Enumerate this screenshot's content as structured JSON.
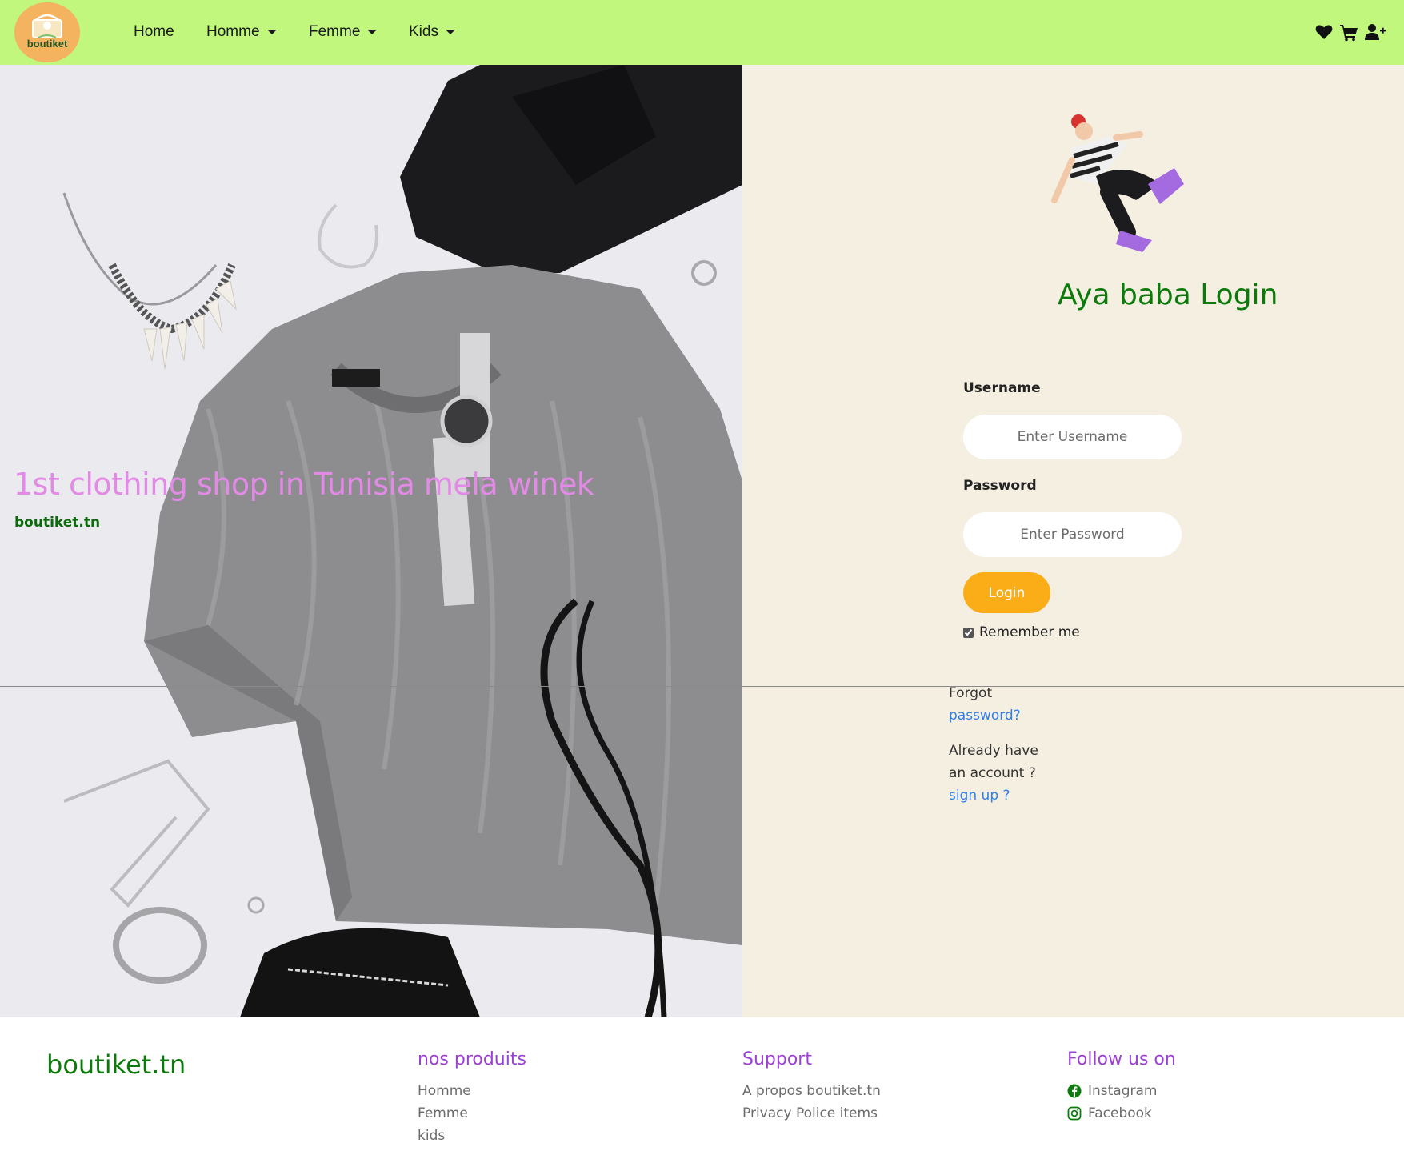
{
  "navbar": {
    "logo_text": "boutiket",
    "items": [
      {
        "label": "Home",
        "has_dropdown": false
      },
      {
        "label": "Homme",
        "has_dropdown": true
      },
      {
        "label": "Femme",
        "has_dropdown": true
      },
      {
        "label": "Kids",
        "has_dropdown": true
      }
    ],
    "icons": [
      "heart-icon",
      "cart-icon",
      "user-plus-icon"
    ]
  },
  "hero": {
    "tagline": "1st clothing shop in Tunisia mela winek",
    "subtitle": "boutiket.tn"
  },
  "login": {
    "title": "Aya baba Login",
    "username_label": "Username",
    "username_placeholder": "Enter Username",
    "password_label": "Password",
    "password_placeholder": "Enter Password",
    "login_button": "Login",
    "remember_label": "Remember me",
    "remember_checked": true,
    "forgot_text": "Forgot",
    "forgot_link": "password?",
    "already_text_1": "Already have",
    "already_text_2": "an account ?",
    "signup_link": "sign up ?"
  },
  "footer": {
    "brand": "boutiket.tn",
    "products": {
      "title": "nos produits",
      "items": [
        "Homme",
        "Femme",
        "kids"
      ]
    },
    "support": {
      "title": "Support",
      "items": [
        "A propos boutiket.tn",
        "Privacy Police items"
      ]
    },
    "follow": {
      "title": "Follow us on",
      "items": [
        "Instagram",
        "Facebook"
      ]
    }
  },
  "colors": {
    "navbar_bg": "#c1f77c",
    "panel_bg": "#f5efe2",
    "title_green": "#0b7a0b",
    "tagline_pink": "#e28ae6",
    "button_orange": "#fbad18",
    "link_blue": "#2f7fe6",
    "footer_heading_purple": "#9b3fd6"
  }
}
